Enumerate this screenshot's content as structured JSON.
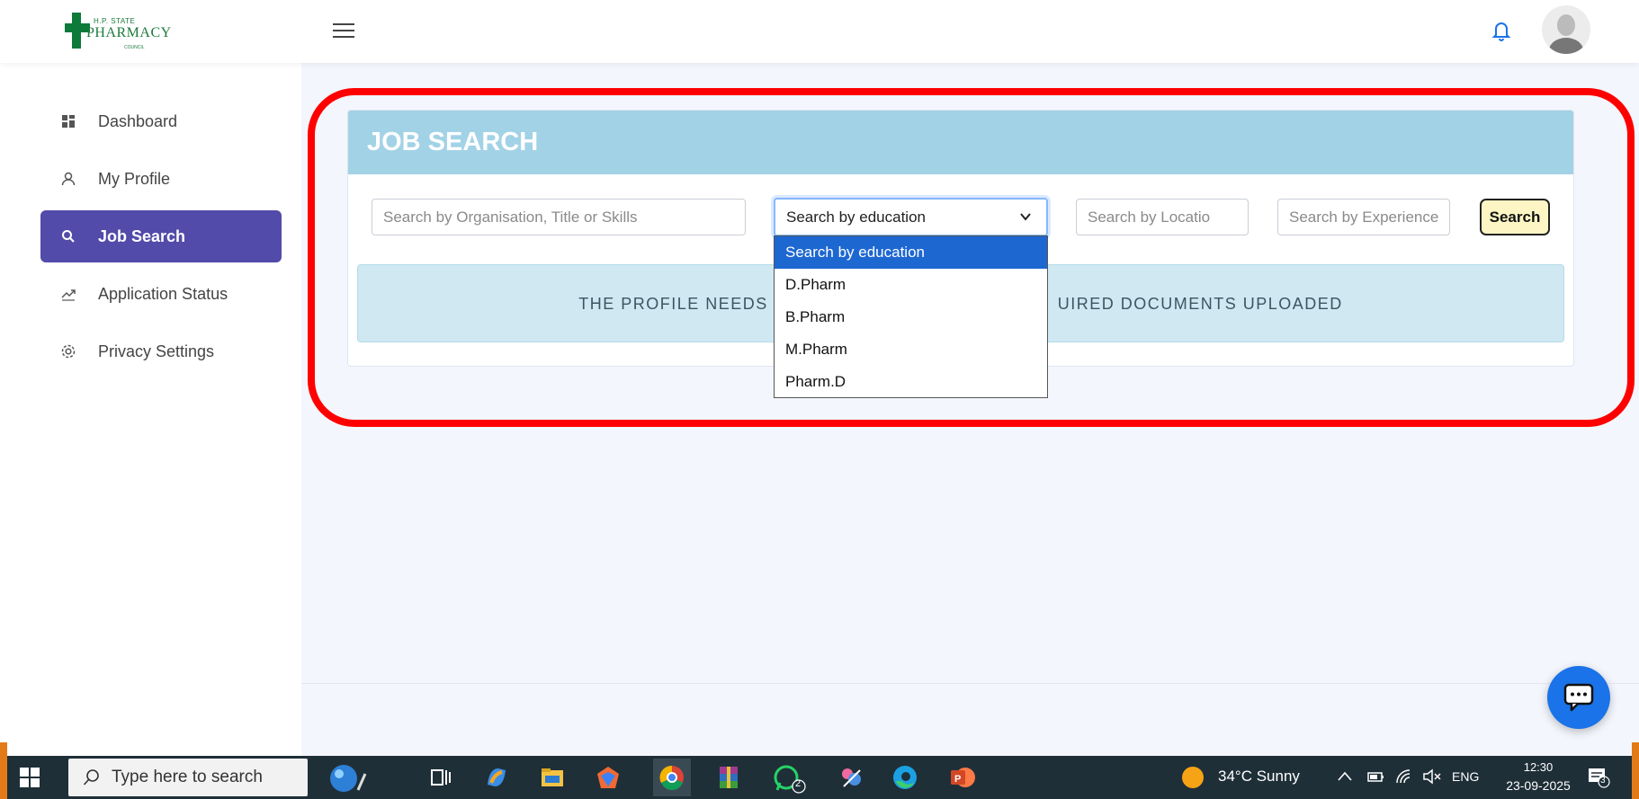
{
  "brand": {
    "line1": "H.P. STATE",
    "line2": "PHARMACY",
    "line3": "COUNCIL"
  },
  "sidebar": {
    "items": [
      {
        "label": "Dashboard",
        "icon": "dashboard-icon"
      },
      {
        "label": "My Profile",
        "icon": "user-icon"
      },
      {
        "label": "Job Search",
        "icon": "search-icon",
        "active": true
      },
      {
        "label": "Application Status",
        "icon": "trend-icon"
      },
      {
        "label": "Privacy Settings",
        "icon": "gear-icon"
      }
    ]
  },
  "job_search": {
    "title": "JOB SEARCH",
    "org_placeholder": "Search by Organisation, Title or Skills",
    "education_selected": "Search by education",
    "education_options": [
      "Search by education",
      "D.Pharm",
      "B.Pharm",
      "M.Pharm",
      "Pharm.D"
    ],
    "location_placeholder": "Search by Locatio",
    "experience_placeholder": "Search by Experience",
    "search_label": "Search",
    "alert_left": "THE PROFILE NEEDS",
    "alert_right": "UIRED DOCUMENTS UPLOADED"
  },
  "colors": {
    "accent": "#524ba9",
    "header_bg": "#a2d2e6",
    "highlight": "#ff0000",
    "chat": "#1a73e8"
  },
  "taskbar": {
    "search_placeholder": "Type here to search",
    "whatsapp_badge": "2",
    "weather": "34°C  Sunny",
    "language": "ENG",
    "time": "12:30",
    "date": "23-09-2025",
    "notification_count": "3"
  }
}
